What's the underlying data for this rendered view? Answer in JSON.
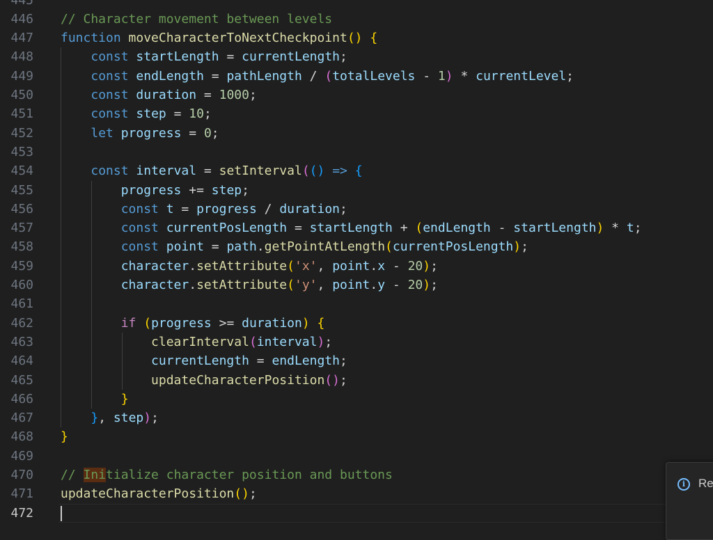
{
  "editor": {
    "first_line_number": 445,
    "active_line": 472,
    "lines": [
      [],
      [
        [
          "comment",
          "// Character movement between levels"
        ]
      ],
      [
        [
          "kw",
          "function"
        ],
        [
          "op",
          " "
        ],
        [
          "fn",
          "moveCharacterToNextCheckpoint"
        ],
        [
          "b1",
          "()"
        ],
        [
          "op",
          " "
        ],
        [
          "b1",
          "{"
        ]
      ],
      [
        [
          "op",
          "    "
        ],
        [
          "kw",
          "const"
        ],
        [
          "op",
          " "
        ],
        [
          "var",
          "startLength"
        ],
        [
          "op",
          " = "
        ],
        [
          "var",
          "currentLength"
        ],
        [
          "op",
          ";"
        ]
      ],
      [
        [
          "op",
          "    "
        ],
        [
          "kw",
          "const"
        ],
        [
          "op",
          " "
        ],
        [
          "var",
          "endLength"
        ],
        [
          "op",
          " = "
        ],
        [
          "var",
          "pathLength"
        ],
        [
          "op",
          " / "
        ],
        [
          "b2",
          "("
        ],
        [
          "var",
          "totalLevels"
        ],
        [
          "op",
          " - "
        ],
        [
          "num",
          "1"
        ],
        [
          "b2",
          ")"
        ],
        [
          "op",
          " * "
        ],
        [
          "var",
          "currentLevel"
        ],
        [
          "op",
          ";"
        ]
      ],
      [
        [
          "op",
          "    "
        ],
        [
          "kw",
          "const"
        ],
        [
          "op",
          " "
        ],
        [
          "var",
          "duration"
        ],
        [
          "op",
          " = "
        ],
        [
          "num",
          "1000"
        ],
        [
          "op",
          ";"
        ]
      ],
      [
        [
          "op",
          "    "
        ],
        [
          "kw",
          "const"
        ],
        [
          "op",
          " "
        ],
        [
          "var",
          "step"
        ],
        [
          "op",
          " = "
        ],
        [
          "num",
          "10"
        ],
        [
          "op",
          ";"
        ]
      ],
      [
        [
          "op",
          "    "
        ],
        [
          "kw",
          "let"
        ],
        [
          "op",
          " "
        ],
        [
          "var",
          "progress"
        ],
        [
          "op",
          " = "
        ],
        [
          "num",
          "0"
        ],
        [
          "op",
          ";"
        ]
      ],
      [],
      [
        [
          "op",
          "    "
        ],
        [
          "kw",
          "const"
        ],
        [
          "op",
          " "
        ],
        [
          "var",
          "interval"
        ],
        [
          "op",
          " = "
        ],
        [
          "fn",
          "setInterval"
        ],
        [
          "b2",
          "("
        ],
        [
          "b3",
          "()"
        ],
        [
          "op",
          " "
        ],
        [
          "kw",
          "=>"
        ],
        [
          "op",
          " "
        ],
        [
          "b3",
          "{"
        ]
      ],
      [
        [
          "op",
          "        "
        ],
        [
          "var",
          "progress"
        ],
        [
          "op",
          " += "
        ],
        [
          "var",
          "step"
        ],
        [
          "op",
          ";"
        ]
      ],
      [
        [
          "op",
          "        "
        ],
        [
          "kw",
          "const"
        ],
        [
          "op",
          " "
        ],
        [
          "var",
          "t"
        ],
        [
          "op",
          " = "
        ],
        [
          "var",
          "progress"
        ],
        [
          "op",
          " / "
        ],
        [
          "var",
          "duration"
        ],
        [
          "op",
          ";"
        ]
      ],
      [
        [
          "op",
          "        "
        ],
        [
          "kw",
          "const"
        ],
        [
          "op",
          " "
        ],
        [
          "var",
          "currentPosLength"
        ],
        [
          "op",
          " = "
        ],
        [
          "var",
          "startLength"
        ],
        [
          "op",
          " + "
        ],
        [
          "b1",
          "("
        ],
        [
          "var",
          "endLength"
        ],
        [
          "op",
          " - "
        ],
        [
          "var",
          "startLength"
        ],
        [
          "b1",
          ")"
        ],
        [
          "op",
          " * "
        ],
        [
          "var",
          "t"
        ],
        [
          "op",
          ";"
        ]
      ],
      [
        [
          "op",
          "        "
        ],
        [
          "kw",
          "const"
        ],
        [
          "op",
          " "
        ],
        [
          "var",
          "point"
        ],
        [
          "op",
          " = "
        ],
        [
          "var",
          "path"
        ],
        [
          "op",
          "."
        ],
        [
          "fn",
          "getPointAtLength"
        ],
        [
          "b1",
          "("
        ],
        [
          "var",
          "currentPosLength"
        ],
        [
          "b1",
          ")"
        ],
        [
          "op",
          ";"
        ]
      ],
      [
        [
          "op",
          "        "
        ],
        [
          "var",
          "character"
        ],
        [
          "op",
          "."
        ],
        [
          "fn",
          "setAttribute"
        ],
        [
          "b1",
          "("
        ],
        [
          "str",
          "'x'"
        ],
        [
          "op",
          ", "
        ],
        [
          "var",
          "point"
        ],
        [
          "op",
          "."
        ],
        [
          "var",
          "x"
        ],
        [
          "op",
          " - "
        ],
        [
          "num",
          "20"
        ],
        [
          "b1",
          ")"
        ],
        [
          "op",
          ";"
        ]
      ],
      [
        [
          "op",
          "        "
        ],
        [
          "var",
          "character"
        ],
        [
          "op",
          "."
        ],
        [
          "fn",
          "setAttribute"
        ],
        [
          "b1",
          "("
        ],
        [
          "str",
          "'y'"
        ],
        [
          "op",
          ", "
        ],
        [
          "var",
          "point"
        ],
        [
          "op",
          "."
        ],
        [
          "var",
          "y"
        ],
        [
          "op",
          " - "
        ],
        [
          "num",
          "20"
        ],
        [
          "b1",
          ")"
        ],
        [
          "op",
          ";"
        ]
      ],
      [],
      [
        [
          "op",
          "        "
        ],
        [
          "ctl",
          "if"
        ],
        [
          "op",
          " "
        ],
        [
          "b1",
          "("
        ],
        [
          "var",
          "progress"
        ],
        [
          "op",
          " >= "
        ],
        [
          "var",
          "duration"
        ],
        [
          "b1",
          ")"
        ],
        [
          "op",
          " "
        ],
        [
          "b1",
          "{"
        ]
      ],
      [
        [
          "op",
          "            "
        ],
        [
          "fn",
          "clearInterval"
        ],
        [
          "b2",
          "("
        ],
        [
          "var",
          "interval"
        ],
        [
          "b2",
          ")"
        ],
        [
          "op",
          ";"
        ]
      ],
      [
        [
          "op",
          "            "
        ],
        [
          "var",
          "currentLength"
        ],
        [
          "op",
          " = "
        ],
        [
          "var",
          "endLength"
        ],
        [
          "op",
          ";"
        ]
      ],
      [
        [
          "op",
          "            "
        ],
        [
          "fn",
          "updateCharacterPosition"
        ],
        [
          "b2",
          "()"
        ],
        [
          "op",
          ";"
        ]
      ],
      [
        [
          "op",
          "        "
        ],
        [
          "b1",
          "}"
        ]
      ],
      [
        [
          "op",
          "    "
        ],
        [
          "b3",
          "}"
        ],
        [
          "op",
          ", "
        ],
        [
          "var",
          "step"
        ],
        [
          "b2",
          ")"
        ],
        [
          "op",
          ";"
        ]
      ],
      [
        [
          "b1",
          "}"
        ]
      ],
      [],
      [
        [
          "comment",
          "// "
        ],
        [
          "commenthl",
          "Ini"
        ],
        [
          "comment",
          "tialize character position and buttons"
        ]
      ],
      [
        [
          "fn",
          "updateCharacterPosition"
        ],
        [
          "b1",
          "()"
        ],
        [
          "op",
          ";"
        ]
      ],
      []
    ]
  },
  "notification": {
    "icon": "info-icon",
    "text": "Re"
  },
  "colors": {
    "background": "#1f1f1f",
    "comment": "#6a9955",
    "keyword": "#569cd6",
    "function": "#dcdcaa",
    "variable": "#9cdcfe",
    "number": "#b5cea8",
    "string": "#ce9178",
    "bracket_gold": "#ffd700",
    "bracket_purple": "#da70d6",
    "bracket_blue": "#179fff"
  }
}
